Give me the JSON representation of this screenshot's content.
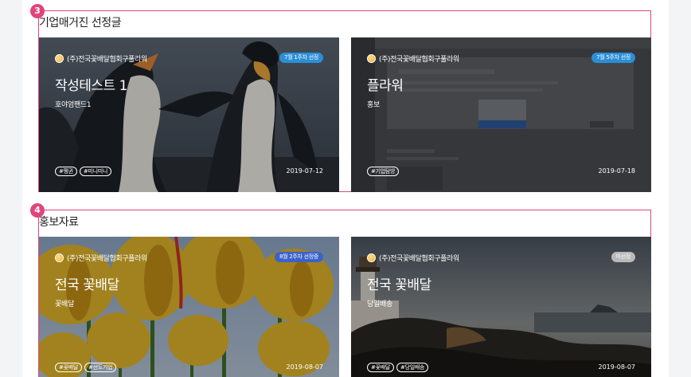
{
  "sections": [
    {
      "number": "3",
      "title": "기업매거진 선정글",
      "cards": [
        {
          "company": "(주)전국꽃배달협회구풀라워",
          "badge": "7월 1주차 선정",
          "badge_color": "#2b8fd6",
          "title": "작성테스트 1",
          "subtitle": "호야엄팬드1",
          "tags": [
            "#펭귄",
            "#미니미니"
          ],
          "date": "2019-07-12",
          "image": "penguins"
        },
        {
          "company": "(주)전국꽃배달협회구풀라워",
          "badge": "7월 5주차 선정",
          "badge_color": "#2b8fd6",
          "title": "플라워",
          "subtitle": "홍보",
          "tags": [
            "#기업탐방"
          ],
          "date": "2019-07-18",
          "image": "screenshot"
        }
      ]
    },
    {
      "number": "4",
      "title": "홍보자료",
      "cards": [
        {
          "company": "(주)전국꽃배달협회구플라워",
          "badge": "8월 2주차 선정중",
          "badge_color": "#3b62c9",
          "title": "전국 꽃배달",
          "subtitle": "꽃배달",
          "tags": [
            "#꽃배달",
            "#선도기업"
          ],
          "date": "2019-08-07",
          "image": "tulips"
        },
        {
          "company": "(주)전국꽃배달협회구플라워",
          "badge": "미선정",
          "badge_color": "#b9b9b9",
          "title": "전국 꽃배달",
          "subtitle": "당일배송",
          "tags": [
            "#꽃배달",
            "#당일배송"
          ],
          "date": "2019-08-07",
          "image": "lighthouse"
        }
      ]
    }
  ]
}
